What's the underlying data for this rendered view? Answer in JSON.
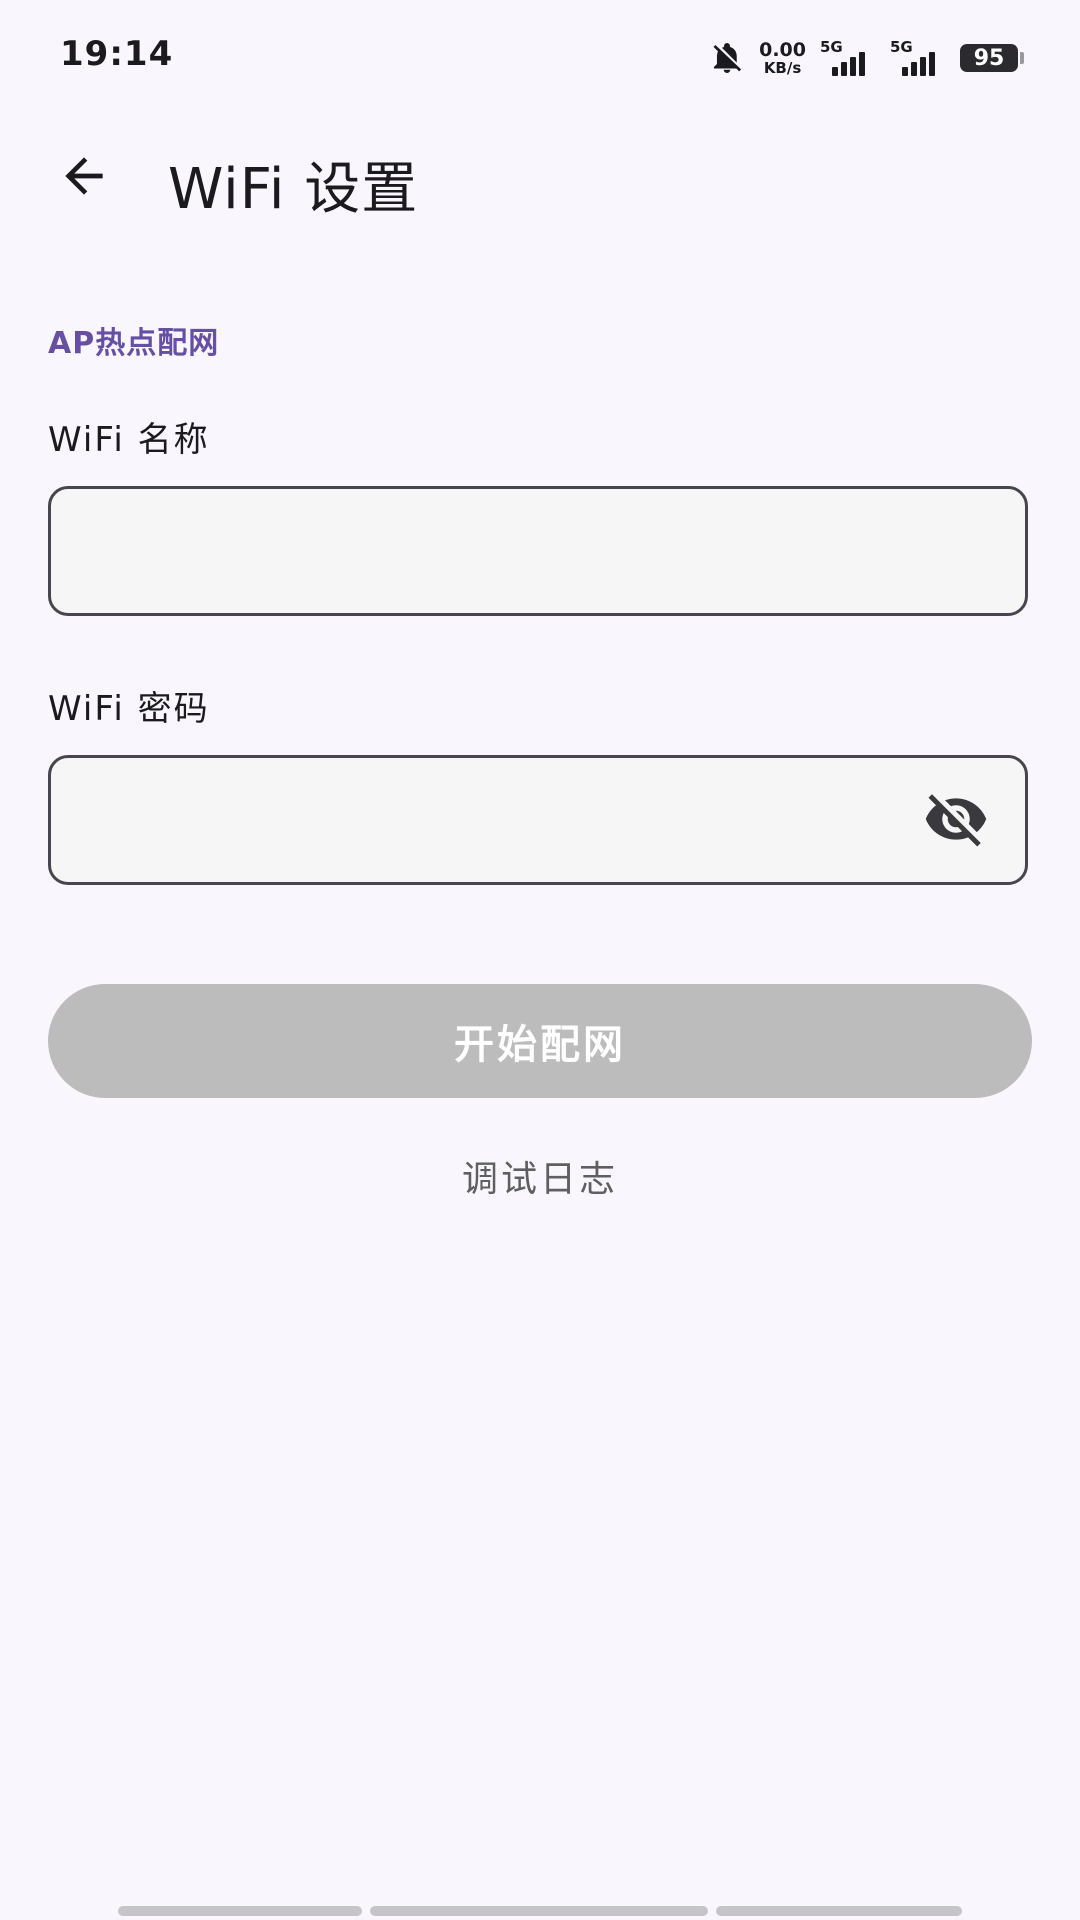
{
  "status_bar": {
    "time": "19:14",
    "net_speed_value": "0.00",
    "net_speed_unit": "KB/s",
    "sim1_type": "5G",
    "sim2_type": "5G",
    "battery_level": "95"
  },
  "app_bar": {
    "title": "WiFi 设置"
  },
  "form": {
    "section_label": "AP热点配网",
    "ssid_label": "WiFi 名称",
    "ssid_value": "",
    "password_label": "WiFi 密码",
    "password_value": ""
  },
  "actions": {
    "start_label": "开始配网",
    "debug_log_label": "调试日志"
  },
  "colors": {
    "accent": "#6750a4",
    "background": "#f9f7fd",
    "button_disabled": "#bcbcbc",
    "field_border": "#49454f"
  }
}
